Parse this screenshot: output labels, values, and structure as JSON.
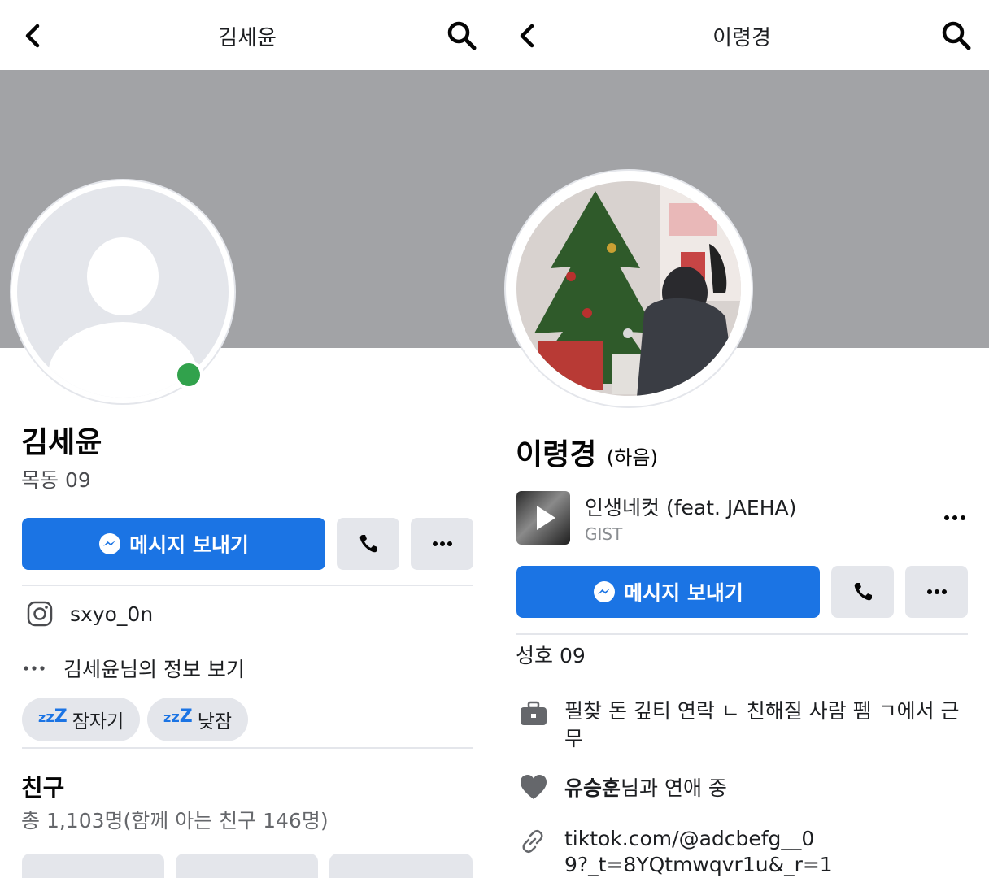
{
  "left": {
    "header_title": "김세윤",
    "name": "김세윤",
    "subtitle": "목동 09",
    "message_button": "메시지 보내기",
    "instagram_handle": "sxyo_0n",
    "more_info": "김세윤님의 정보 보기",
    "chips": [
      "잠자기",
      "낮잠"
    ],
    "friends_title": "친구",
    "friends_count": "총 1,103명(함께 아는 친구 146명)"
  },
  "right": {
    "header_title": "이령경",
    "name": "이령경",
    "nickname": "(하음)",
    "song_title": "인생네컷 (feat. JAEHA)",
    "song_artist": "GIST",
    "message_button": "메시지 보내기",
    "school": "성호 09",
    "work": "필찾 돈 깊티 연락 ㄴ 친해질 사람 펨 ㄱ에서 근무",
    "relationship_name": "유승훈",
    "relationship_rest": "님과 연애 중",
    "link": "tiktok.com/@adcbefg__09?_t=8YQtmwqvr1u&_r=1"
  },
  "icons": {
    "back": "chevron-left-icon",
    "search": "search-icon",
    "messenger": "messenger-icon",
    "phone": "phone-icon",
    "more": "more-dots-icon",
    "instagram": "instagram-icon",
    "work": "briefcase-icon",
    "heart": "heart-icon",
    "link": "link-icon",
    "zzz": "zzz-icon"
  },
  "colors": {
    "primary": "#1b74e4",
    "cover": "#a2a3a6",
    "online": "#31a24c",
    "button_gray": "#e4e6eb"
  }
}
